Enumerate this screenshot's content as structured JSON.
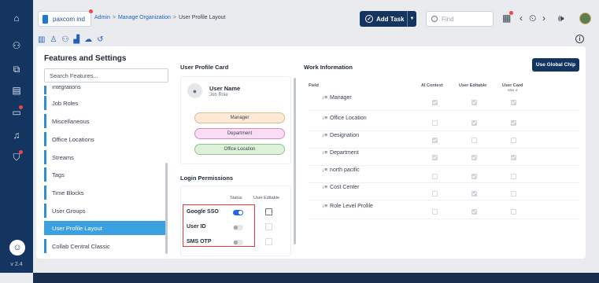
{
  "rail": {
    "version": "v 2.4",
    "icons": [
      "home-icon",
      "users-icon",
      "org-icon",
      "document-icon",
      "chat-icon",
      "bell-icon",
      "shield-icon"
    ]
  },
  "topbar": {
    "org_name": "paxcom ind",
    "breadcrumb": {
      "admin": "Admin",
      "sep": ">",
      "manage": "Manage Organization",
      "current": "User Profile Layout"
    },
    "add_task": "Add Task",
    "find_placeholder": "Find"
  },
  "toolbar_icons": [
    "org-chart-icon",
    "user-icon",
    "users-group-icon",
    "chart-icon",
    "cloud-icon",
    "history-icon"
  ],
  "features": {
    "title": "Features and Settings",
    "search_placeholder": "Search Features...",
    "partial_item": "Integrations",
    "items": [
      "Job Roles",
      "Miscellaneous",
      "Office Locations",
      "Streams",
      "Tags",
      "Time Blocks",
      "User Groups",
      "User Profile Layout",
      "Collab Central Classic"
    ],
    "active": "User Profile Layout"
  },
  "profile_card": {
    "title": "User Profile Card",
    "user_name": "User Name",
    "job_role": "Job Role",
    "pills": [
      {
        "label": "Manager",
        "bg": "#fde9d5",
        "border": "#e2b88c"
      },
      {
        "label": "Department",
        "bg": "#fbdcf4",
        "border": "#d48cc6"
      },
      {
        "label": "Office Location",
        "bg": "#ddf0d9",
        "border": "#93c48a"
      }
    ]
  },
  "login": {
    "title": "Login Permissions",
    "col_status": "Status",
    "col_editable": "User Editable",
    "rows": [
      {
        "name": "Google SSO",
        "status": true,
        "editable": false
      },
      {
        "name": "User ID",
        "status": false,
        "editable": false
      },
      {
        "name": "SMS OTP",
        "status": false,
        "editable": false
      }
    ]
  },
  "work": {
    "title": "Work Information",
    "global_chip": "Use Global Chip",
    "columns": {
      "field": "Field",
      "ai": "AI Context",
      "editable": "User Editable",
      "card": "User Card",
      "card_max": "Max 4"
    },
    "rows": [
      {
        "name": "Manager",
        "ai": true,
        "editable": true,
        "card": true
      },
      {
        "name": "Office Location",
        "ai": false,
        "editable": true,
        "card": true
      },
      {
        "name": "Designation",
        "ai": true,
        "editable": false,
        "card": false
      },
      {
        "name": "Department",
        "ai": true,
        "editable": true,
        "card": true
      },
      {
        "name": "north pacific",
        "ai": false,
        "editable": true,
        "card": false
      },
      {
        "name": "Cost Center",
        "ai": false,
        "editable": true,
        "card": false
      },
      {
        "name": "Role Level Profile",
        "ai": false,
        "editable": true,
        "card": false
      }
    ]
  },
  "colors": {
    "primary": "#14355f",
    "accent": "#3aa0e0",
    "highlight": "#e53935"
  }
}
